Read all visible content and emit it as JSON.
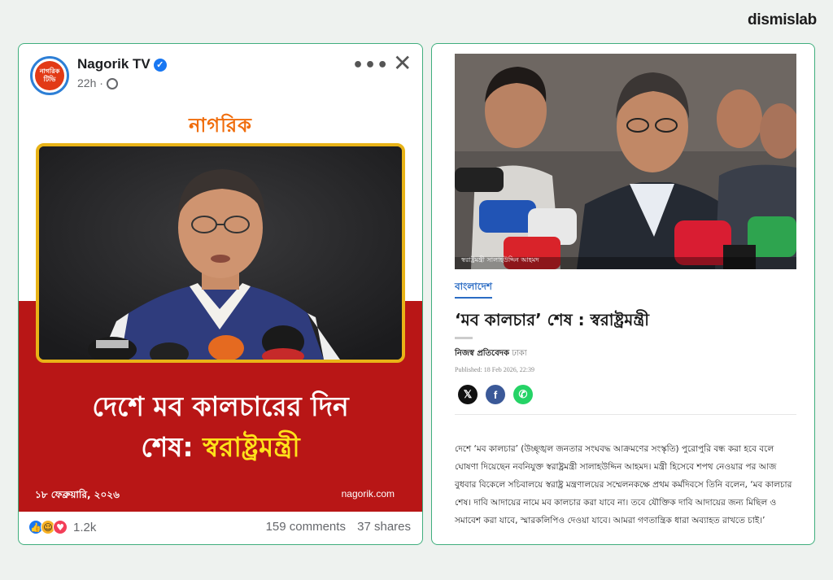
{
  "brand": "dismislab",
  "facebook_post": {
    "page_name": "Nagorik TV",
    "avatar_text": [
      "নাগরিক",
      "টিভি"
    ],
    "time": "22h",
    "image": {
      "logo": "নাগরিক",
      "headline_line1": "দেশে মব কালচারের দিন",
      "headline_line2_prefix": "শেষ: ",
      "headline_line2_highlight": "স্বরাষ্ট্রমন্ত্রী",
      "date": "১৮ ফেব্রুয়ারি, ২০২৬",
      "url": "nagorik.com"
    },
    "reaction_count": "1.2k",
    "comments": "159 comments",
    "shares": "37 shares",
    "colors": {
      "brand_orange": "#f06d0c",
      "banner_red": "#b81616",
      "highlight_yellow": "#ffe21a",
      "frame_gold": "#e8b317"
    }
  },
  "news_article": {
    "photo_caption": "স্বরাষ্ট্রমন্ত্রী সালাহউদ্দিন আহমদ",
    "category": "বাংলাদেশ",
    "title": "‘মব কালচার’ শেষ : স্বরাষ্ট্রমন্ত্রী",
    "byline": "নিজস্ব প্রতিবেদক",
    "byline_location": " ঢাকা",
    "published": "Published: 18 Feb 2026, 22:39",
    "share_icons": [
      "x-icon",
      "facebook-icon",
      "whatsapp-icon"
    ],
    "body": "দেশে ‘মব কালচার’ (উচ্ছৃঙ্খল জনতার সংঘবদ্ধ আক্রমণের সংস্কৃতি) পুরোপুরি বন্ধ করা হবে বলে ঘোষণা দিয়েছেন নবনিযুক্ত স্বরাষ্ট্রমন্ত্রী সালাহউদ্দিন আহমদ। মন্ত্রী হিসেবে শপথ নেওয়ার পর আজ বুধবার বিকেলে সচিবালয়ে স্বরাষ্ট্র মন্ত্রণালয়ের সম্মেলনকক্ষে প্রথম কর্মদিবসে তিনি বলেন, ‘মব কালচার শেষ। দাবি আদায়ের নামে মব কালচার করা যাবে না। তবে যৌক্তিক দাবি আদায়ের জন্য মিছিল ও সমাবেশ করা যাবে, স্মারকলিপিও দেওয়া যাবে। আমরা গণতান্ত্রিক ধারা অব্যাহত রাখতে চাই।’"
  }
}
